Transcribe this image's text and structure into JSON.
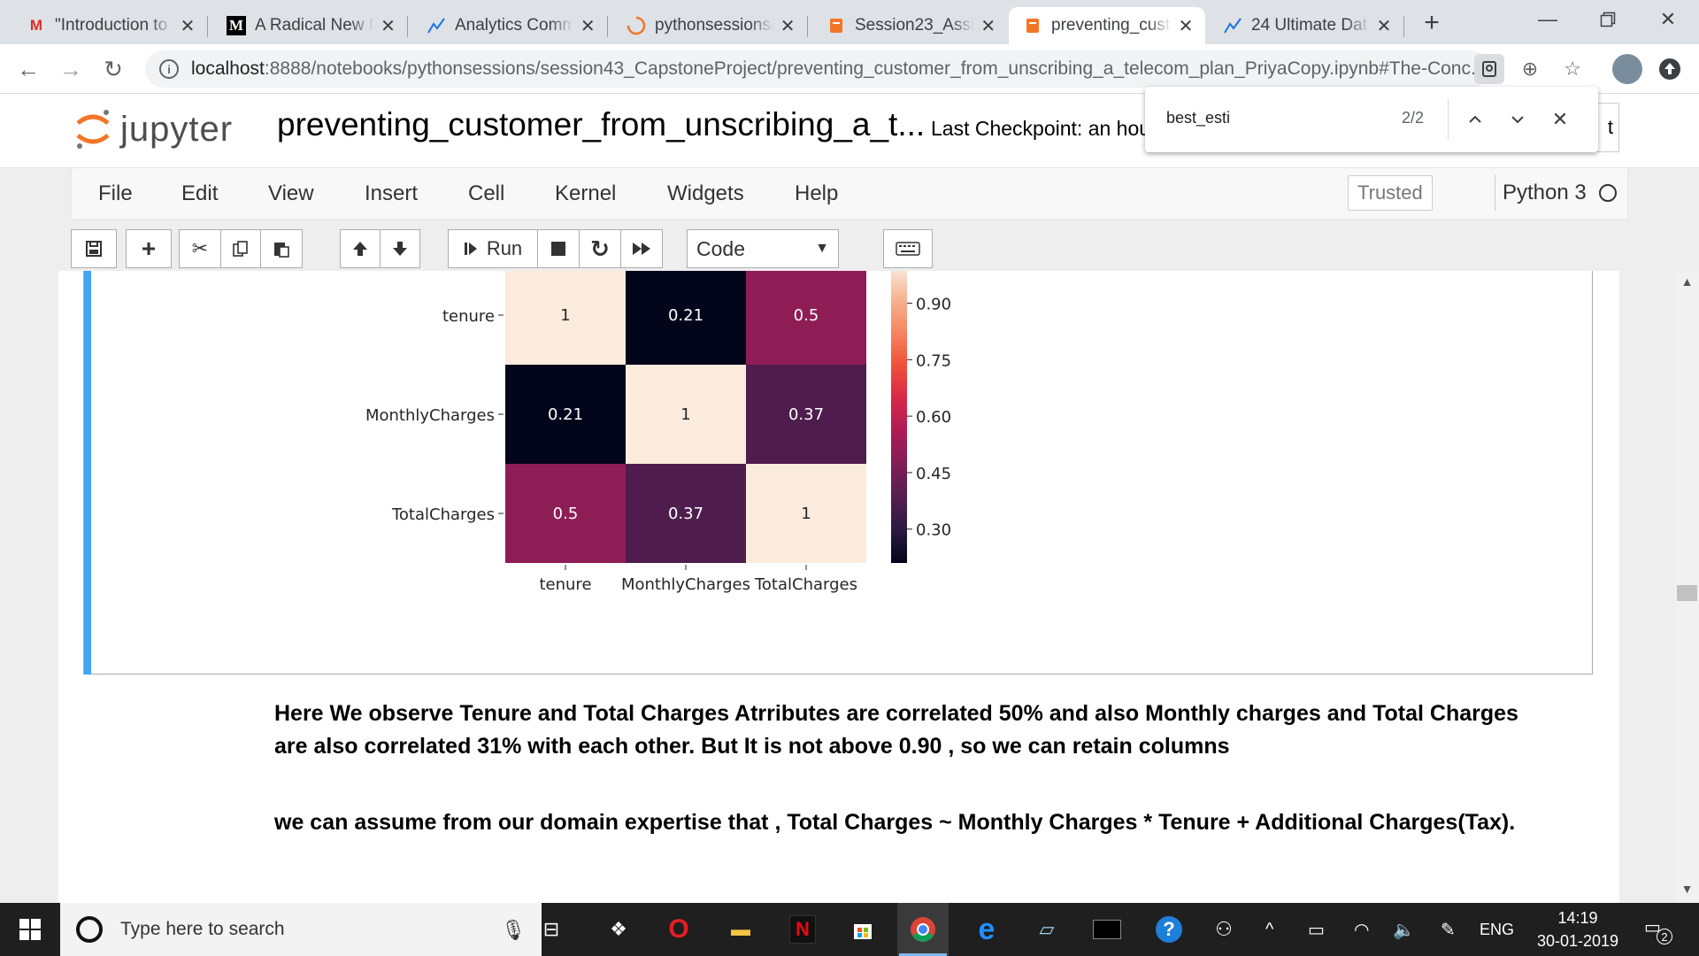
{
  "browser": {
    "tabs": [
      {
        "icon": "gmail-icon",
        "title": "\"Introduction to",
        "active": false
      },
      {
        "icon": "medium-icon",
        "title": "A Radical New N",
        "active": false
      },
      {
        "icon": "analytics-icon",
        "title": "Analytics Comm",
        "active": false
      },
      {
        "icon": "loading-icon",
        "title": "pythonsessions/",
        "active": false
      },
      {
        "icon": "notebook-icon",
        "title": "Session23_Assig",
        "active": false
      },
      {
        "icon": "notebook-icon",
        "title": "preventing_cust",
        "active": true
      },
      {
        "icon": "analytics-icon",
        "title": "24 Ultimate Dat",
        "active": false
      }
    ],
    "url_host": "localhost",
    "url_path": ":8888/notebooks/pythonsessions/session43_CapstoneProject/preventing_customer_from_unscribing_a_telecom_plan_PriyaCopy.ipynb#The-Conc...",
    "find": {
      "query": "best_esti",
      "count": "2/2"
    }
  },
  "jupyter": {
    "logo_text": "jupyter",
    "notebook_name": "preventing_customer_from_unscribing_a_t...",
    "checkpoint": "Last Checkpoint: an hour ago",
    "logout_stub": "t",
    "menu": [
      "File",
      "Edit",
      "View",
      "Insert",
      "Cell",
      "Kernel",
      "Widgets",
      "Help"
    ],
    "trusted": "Trusted",
    "kernel": "Python 3",
    "toolbar": {
      "run_label": "Run",
      "cell_type": "Code"
    }
  },
  "chart_data": {
    "type": "heatmap",
    "rows": [
      "tenure",
      "MonthlyCharges",
      "TotalCharges"
    ],
    "columns": [
      "tenure",
      "MonthlyCharges",
      "TotalCharges"
    ],
    "values": [
      [
        1,
        0.21,
        0.5
      ],
      [
        0.21,
        1,
        0.37
      ],
      [
        0.5,
        0.37,
        1
      ]
    ],
    "labels": [
      [
        "1",
        "0.21",
        "0.5"
      ],
      [
        "0.21",
        "1",
        "0.37"
      ],
      [
        "0.5",
        "0.37",
        "1"
      ]
    ],
    "colorbar": {
      "ticks": [
        "0.90",
        "0.75",
        "0.60",
        "0.45",
        "0.30"
      ],
      "tick_values": [
        0.9,
        0.75,
        0.6,
        0.45,
        0.3
      ],
      "range": [
        0.21,
        1
      ]
    },
    "colormap": [
      "#03051a",
      "#2b1a42",
      "#551e4f",
      "#811d55",
      "#ae1c56",
      "#d92847",
      "#f0513b",
      "#f58762",
      "#f5b491",
      "#faebdd"
    ]
  },
  "markdown": {
    "p1": "Here We observe Tenure and Total Charges Atrributes are correlated 50% and also Monthly charges and Total Charges are also correlated 31% with each other. But It is not above 0.90 , so we can retain columns",
    "p2": "we can assume from our domain expertise that , Total Charges ~ Monthly Charges * Tenure + Additional Charges(Tax)."
  },
  "taskbar": {
    "search_placeholder": "Type here to search",
    "lang": "ENG",
    "time": "14:19",
    "date": "30-01-2019",
    "notifications": "2"
  }
}
